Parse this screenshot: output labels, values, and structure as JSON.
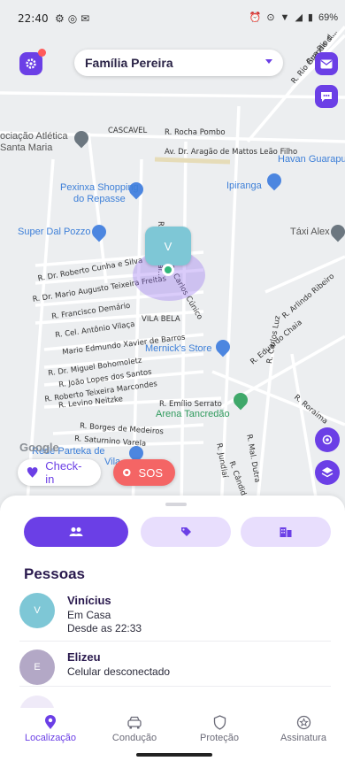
{
  "status_bar": {
    "time": "22:40",
    "battery": "69%"
  },
  "header": {
    "family_name": "Família Pereira"
  },
  "map": {
    "streets": [
      "R. Rocha Pombo",
      "CASCAVEL",
      "Av. Dr. Aragão de Mattos Leão Filho",
      "R. Dr. Roberto Cunha e Silva",
      "R. Dr. Mario Augusto Teixeira Freitas",
      "R. Francisco Demário",
      "R. Cel. Antônio Vilaça",
      "VILA BELA",
      "Mario Edmundo Xavier de Barros",
      "R. Dr. Miguel Bohomoletz",
      "R. João Lopes dos Santos",
      "R. Roberto Teixeira Marcondes",
      "R. Levino Neitzke",
      "R. Emílio Serrato",
      "R. Borges de Medeiros",
      "R. Saturnino Varela",
      "R. Miguel Gar...",
      "R. Carlos Cúnico",
      "R. Arlindo Ribeiro",
      "R. Eduardo Chaia",
      "R. Roraima",
      "R. Mal. Dutra",
      "R. Carlos Luz",
      "R. Cândido Xavier",
      "R. Jundiaí",
      "R. Rio Grande d...",
      "Rua Rio d..."
    ],
    "pois": {
      "associacao": "ociação Atlética\nSanta Maria",
      "havan": "Havan Guarapu",
      "peixinxa": "Pexinxa Shopping\ndo Repasse",
      "ipiranga": "Ipiranga",
      "super_dal_pozzo": "Super Dal Pozzo",
      "taxi_alex": "Táxi Alex",
      "mernicks": "Mernick's Store",
      "arena": "Arena Tancredão",
      "rede_parteka": "Rede Parteka de",
      "vila_fragment": "Vila"
    },
    "google_logo": "Google",
    "avatar_initial": "V"
  },
  "actions": {
    "checkin_label": "Check-in",
    "sos_label": "SOS"
  },
  "sheet": {
    "title": "Pessoas",
    "people": [
      {
        "initial": "V",
        "name": "Vinícius",
        "status": "Em Casa",
        "since": "Desde as 22:33",
        "color": "#7ec7d6"
      },
      {
        "initial": "E",
        "name": "Elizeu",
        "status": "Celular desconectado",
        "since": "",
        "color": "#b3a8c6"
      }
    ]
  },
  "nav": {
    "items": [
      {
        "label": "Localização",
        "icon": "location-pin-icon",
        "active": true
      },
      {
        "label": "Condução",
        "icon": "car-icon",
        "active": false
      },
      {
        "label": "Proteção",
        "icon": "shield-icon",
        "active": false
      },
      {
        "label": "Assinatura",
        "icon": "star-badge-icon",
        "active": false
      }
    ]
  },
  "colors": {
    "accent": "#6b3fe6",
    "accent_light": "#e8defd",
    "sos": "#f46565"
  }
}
